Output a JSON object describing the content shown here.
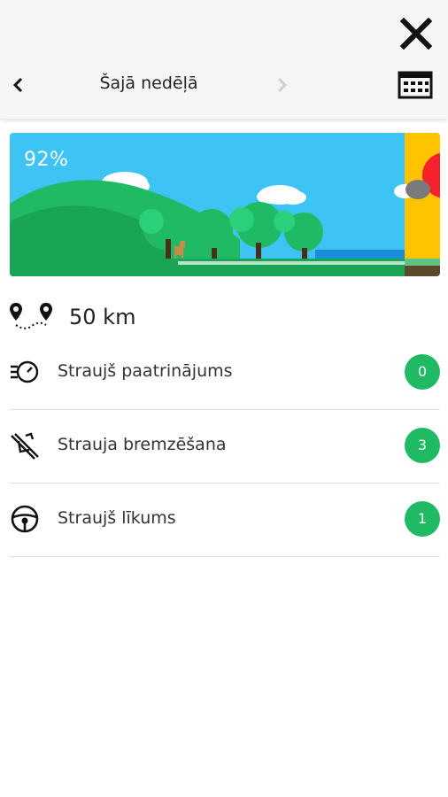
{
  "header": {
    "title": "Šajā nedēļā",
    "close_icon": "close-icon",
    "back_icon": "chevron-left-icon",
    "forward_icon": "chevron-right-icon",
    "calendar_icon": "calendar-icon"
  },
  "banner": {
    "score": "92%",
    "colors": {
      "sky": "#3ec3f5",
      "hills": "#1fba63",
      "sun_panel": "#ffc400"
    }
  },
  "distance": {
    "icon": "route-pins-icon",
    "value": "50 km"
  },
  "events": [
    {
      "label": "Straujš paatrinājums",
      "count": "0",
      "icon": "speedometer-icon"
    },
    {
      "label": "Strauja bremzēšana",
      "count": "3",
      "icon": "brake-icon"
    },
    {
      "label": "Straujš līkums",
      "count": "1",
      "icon": "steering-wheel-icon"
    }
  ],
  "colors": {
    "badge": "#1fba63",
    "divider": "#dedede"
  }
}
